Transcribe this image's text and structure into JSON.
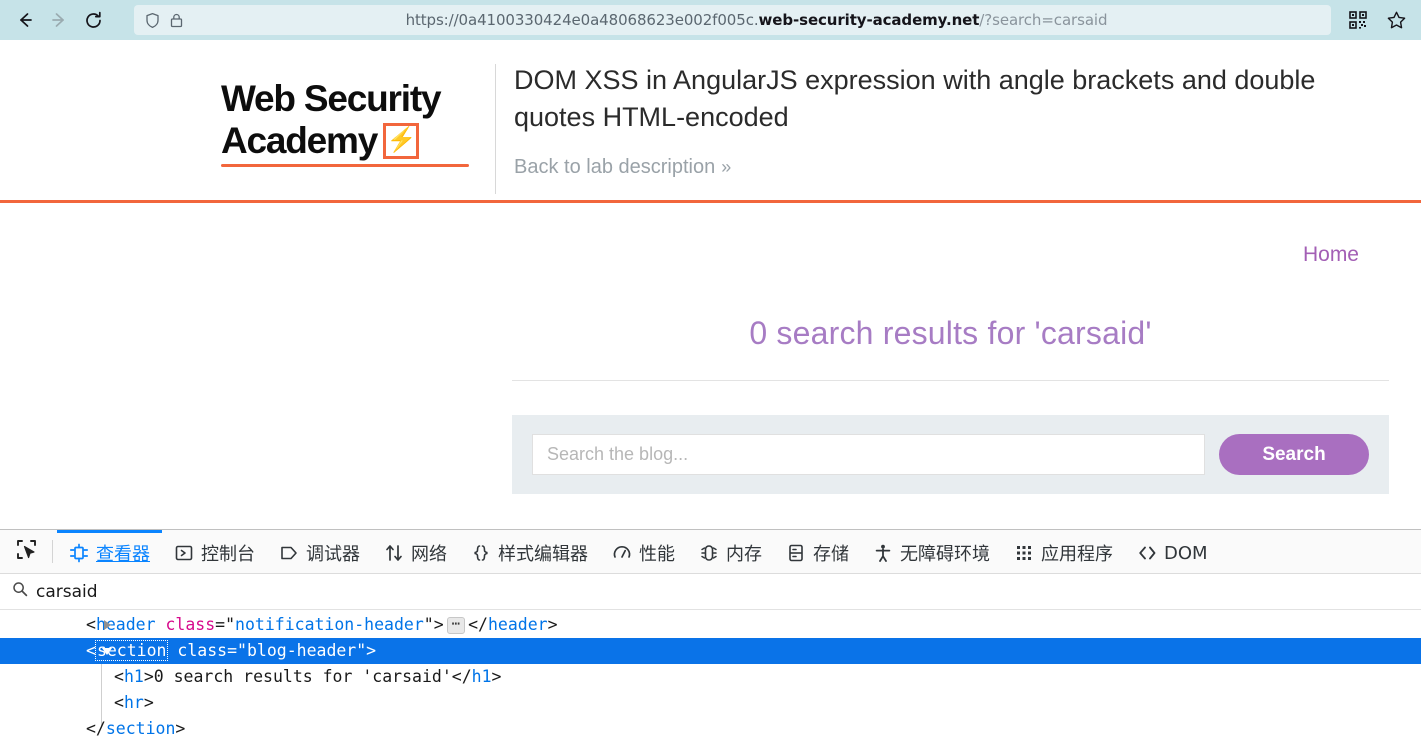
{
  "browser": {
    "back_icon": "back-arrow-icon",
    "forward_icon": "forward-arrow-icon",
    "reload_icon": "reload-icon",
    "shield_icon": "shield-icon",
    "lock_icon": "padlock-icon",
    "url_scheme": "https://",
    "url_subdomain": "0a4100330424e0a48068623e002f005c.",
    "url_host": "web-security-academy.net",
    "url_path": "/?search=carsaid",
    "url_full": "https://0a4100330424e0a48068623e002f005c.web-security-academy.net/?search=carsaid",
    "qr_icon": "qr-code-icon",
    "bookmark_icon": "star-bookmark-icon"
  },
  "site": {
    "logo_line1": "Web Security",
    "logo_line2": "Academy",
    "logo_bolt_glyph": "⚡",
    "lab_title": "DOM XSS in AngularJS expression with angle brackets and double quotes HTML-encoded",
    "back_link": "Back to lab description",
    "back_link_chevron": "»",
    "accent_color": "#f2663c"
  },
  "page": {
    "home_link": "Home",
    "results_heading": "0 search results for 'carsaid'",
    "search_placeholder": "Search the blog...",
    "search_value": "",
    "search_button": "Search",
    "heading_color": "#a77cc4",
    "link_color": "#a35fb5",
    "button_color": "#a96fc0"
  },
  "devtools": {
    "picker_icon": "element-picker-icon",
    "tabs": [
      {
        "label": "查看器",
        "icon": "inspector-icon",
        "active": true
      },
      {
        "label": "控制台",
        "icon": "console-icon",
        "active": false
      },
      {
        "label": "调试器",
        "icon": "debugger-icon",
        "active": false
      },
      {
        "label": "网络",
        "icon": "network-icon",
        "active": false
      },
      {
        "label": "样式编辑器",
        "icon": "style-editor-icon",
        "active": false
      },
      {
        "label": "性能",
        "icon": "performance-icon",
        "active": false
      },
      {
        "label": "内存",
        "icon": "memory-icon",
        "active": false
      },
      {
        "label": "存储",
        "icon": "storage-icon",
        "active": false
      },
      {
        "label": "无障碍环境",
        "icon": "accessibility-icon",
        "active": false
      },
      {
        "label": "应用程序",
        "icon": "application-icon",
        "active": false
      },
      {
        "label": "DOM",
        "icon": "dom-icon",
        "active": false
      }
    ],
    "filter": {
      "icon": "search-icon",
      "value": "carsaid"
    },
    "dom_rows": [
      {
        "indent": 1,
        "twisty": "closed",
        "selected": false,
        "parts": [
          {
            "t": "punct",
            "v": "<"
          },
          {
            "t": "tag",
            "v": "header"
          },
          {
            "t": "punct",
            "v": " "
          },
          {
            "t": "attr",
            "v": "class"
          },
          {
            "t": "punct",
            "v": "=\""
          },
          {
            "t": "val",
            "v": "notification-header"
          },
          {
            "t": "punct",
            "v": "\">"
          },
          {
            "t": "badge",
            "v": "⋯"
          },
          {
            "t": "punct",
            "v": "</"
          },
          {
            "t": "tag",
            "v": "header"
          },
          {
            "t": "punct",
            "v": ">"
          }
        ]
      },
      {
        "indent": 1,
        "twisty": "open",
        "selected": true,
        "parts": [
          {
            "t": "punct",
            "v": "<"
          },
          {
            "t": "tagbox",
            "v": "section"
          },
          {
            "t": "punct",
            "v": " "
          },
          {
            "t": "attr",
            "v": "class"
          },
          {
            "t": "punct",
            "v": "=\""
          },
          {
            "t": "val",
            "v": "blog-header"
          },
          {
            "t": "punct",
            "v": "\">"
          }
        ]
      },
      {
        "indent": 2,
        "twisty": "none",
        "selected": false,
        "parts": [
          {
            "t": "punct",
            "v": "<"
          },
          {
            "t": "tag",
            "v": "h1"
          },
          {
            "t": "punct",
            "v": ">"
          },
          {
            "t": "txt",
            "v": "0 search results for 'carsaid'"
          },
          {
            "t": "punct",
            "v": "</"
          },
          {
            "t": "tag",
            "v": "h1"
          },
          {
            "t": "punct",
            "v": ">"
          }
        ]
      },
      {
        "indent": 2,
        "twisty": "none",
        "selected": false,
        "parts": [
          {
            "t": "punct",
            "v": "<"
          },
          {
            "t": "tag",
            "v": "hr"
          },
          {
            "t": "punct",
            "v": ">"
          }
        ]
      },
      {
        "indent": 1,
        "twisty": "none",
        "selected": false,
        "parts": [
          {
            "t": "punct",
            "v": "</"
          },
          {
            "t": "tag",
            "v": "section"
          },
          {
            "t": "punct",
            "v": ">"
          }
        ]
      }
    ]
  }
}
